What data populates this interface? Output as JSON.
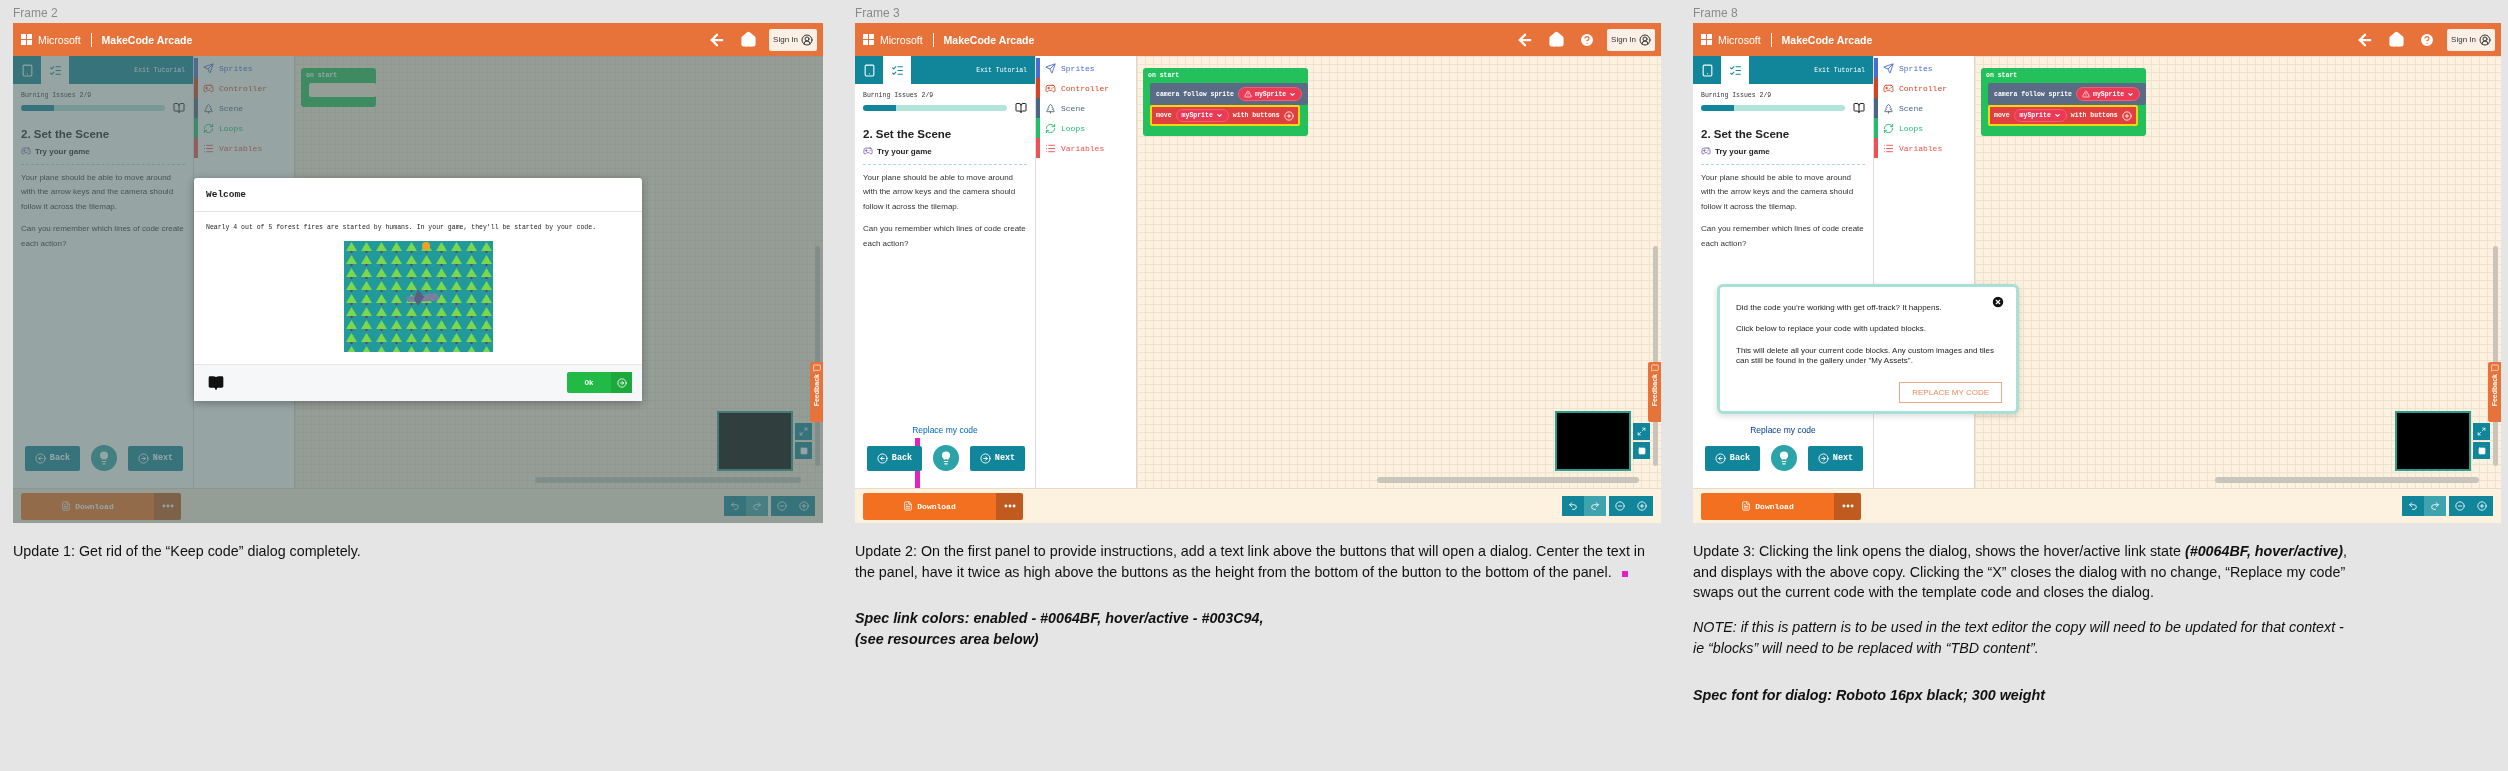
{
  "frames": [
    {
      "label": "Frame 2",
      "dimmed": true,
      "header": {
        "brand": "Microsoft",
        "product": "MakeCode Arcade",
        "sign_in": "Sign In",
        "help": false
      },
      "tutorial": {
        "tabs": [
          {
            "kind": "simulator",
            "selected": false
          },
          {
            "kind": "steps",
            "selected": true
          }
        ],
        "exit": "Exit Tutorial",
        "progress_label": "Burning Issues 2/9",
        "level": 0.23,
        "title": "2. Set the Scene",
        "subtitle": "Try your game",
        "paragraphs": [
          "Your plane should be able to move around with the arrow keys and the camera should follow it across the tilemap.",
          "Can you remember which lines of code create each action?"
        ],
        "back": "Back",
        "next": "Next",
        "marker": false
      },
      "toolbox": [
        {
          "kind": "sprites",
          "label": "Sprites"
        },
        {
          "kind": "controller",
          "label": "Controller"
        },
        {
          "kind": "scene",
          "label": "Scene"
        },
        {
          "kind": "loops",
          "label": "Loops"
        },
        {
          "kind": "variables",
          "label": "Variables"
        }
      ],
      "blocks": {
        "event": "on start"
      },
      "download": "Download",
      "feedback": "Feedback",
      "modal": {
        "title": "Welcome",
        "text": "Nearly 4 out of 5 forest fires are started by humans. In your game, they'll be started by your code.",
        "button": "Ok"
      }
    },
    {
      "label": "Frame 3",
      "dimmed": false,
      "header": {
        "brand": "Microsoft",
        "product": "MakeCode Arcade",
        "sign_in": "Sign In",
        "help": true
      },
      "tutorial": {
        "tabs": [
          {
            "kind": "simulator",
            "selected": false
          },
          {
            "kind": "steps",
            "selected": true
          }
        ],
        "exit": "Exit Tutorial",
        "progress_label": "Burning Issues 2/9",
        "level": 0.23,
        "title": "2. Set the Scene",
        "subtitle": "Try your game",
        "paragraphs": [
          "Your plane should be able to move around with the arrow keys and the camera should follow it across the tilemap.",
          "Can you remember which lines of code create each action?"
        ],
        "link": {
          "text": "Replace my code",
          "active": false
        },
        "back": "Back",
        "next": "Next",
        "marker": true
      },
      "toolbox": [
        {
          "kind": "sprites",
          "label": "Sprites"
        },
        {
          "kind": "controller",
          "label": "Controller"
        },
        {
          "kind": "scene",
          "label": "Scene"
        },
        {
          "kind": "loops",
          "label": "Loops"
        },
        {
          "kind": "variables",
          "label": "Variables"
        }
      ],
      "blocks": {
        "event": "on start",
        "statements": [
          {
            "kind": "follow",
            "label": "camera follow sprite",
            "sprite": "mySprite"
          },
          {
            "kind": "move",
            "label": "move",
            "sprite": "mySprite",
            "suffix": "with buttons"
          }
        ]
      },
      "download": "Download",
      "feedback": "Feedback"
    },
    {
      "label": "Frame 8",
      "dimmed": false,
      "header": {
        "brand": "Microsoft",
        "product": "MakeCode Arcade",
        "sign_in": "Sign In",
        "help": true
      },
      "tutorial": {
        "tabs": [
          {
            "kind": "simulator",
            "selected": false
          },
          {
            "kind": "steps",
            "selected": true
          }
        ],
        "exit": "Exit Tutorial",
        "progress_label": "Burning Issues 2/9",
        "level": 0.23,
        "title": "2. Set the Scene",
        "subtitle": "Try your game",
        "paragraphs": [
          "Your plane should be able to move around with the arrow keys and the camera should follow it across the tilemap.",
          "Can you remember which lines of code create each action?"
        ],
        "link": {
          "text": "Replace my code",
          "active": true
        },
        "back": "Back",
        "next": "Next",
        "marker": false
      },
      "toolbox": [
        {
          "kind": "sprites",
          "label": "Sprites"
        },
        {
          "kind": "controller",
          "label": "Controller"
        },
        {
          "kind": "scene",
          "label": "Scene"
        },
        {
          "kind": "loops",
          "label": "Loops"
        },
        {
          "kind": "variables",
          "label": "Variables"
        }
      ],
      "blocks": {
        "event": "on start",
        "statements": [
          {
            "kind": "follow",
            "label": "camera follow sprite",
            "sprite": "mySprite"
          },
          {
            "kind": "move",
            "label": "move",
            "sprite": "mySprite",
            "suffix": "with buttons"
          }
        ]
      },
      "download": "Download",
      "feedback": "Feedback",
      "popover": {
        "paragraphs": [
          "Did the code you’re working with get off-track? It happens.",
          "Click below to replace your code with updated blocks.",
          "This will delete all your current code blocks. Any custom images and tiles can still be found in the gallery under \"My Assets\"."
        ],
        "button": "REPLACE MY CODE"
      }
    }
  ],
  "captions": [
    [
      {
        "kind": "plain",
        "text": "Update 1: Get rid of the “Keep code” dialog completely."
      }
    ],
    [
      {
        "kind": "plain",
        "text": "Update 2: On the first panel to provide instructions, add a text link above the buttons that will open a dialog. Center the text in the panel, have it twice as high above the buttons as the height from the bottom of the button to the bottom of the panel.",
        "marker": true
      },
      {
        "kind": "spec",
        "text": "Spec link colors: enabled - #0064BF,  hover/active - #003C94,\n(see resources area below)"
      }
    ],
    [
      {
        "kind": "plain",
        "text": "Update 3: Clicking the link opens the dialog, shows the hover/active link state **(#0064BF,  hover/active)**, and displays with the above copy. Clicking the “X” closes the dialog with no change, “Replace my code” swaps out the current code with the template code and closes the dialog."
      },
      {
        "kind": "note",
        "text": "NOTE: if this is pattern is to be used in the text editor the copy will need to be updated for that context - ie “blocks” will need to be replaced with “TBD content”."
      },
      {
        "kind": "spec",
        "text": "Spec font for dialog: Roboto 16px black; 300 weight"
      }
    ]
  ]
}
